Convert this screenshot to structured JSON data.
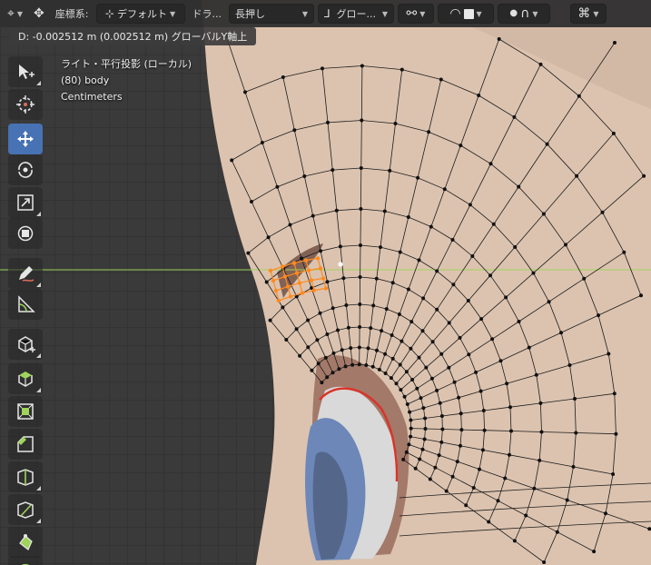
{
  "header": {
    "coord_label": "座標系:",
    "pivot_value": "デフォルト",
    "drag_label": "ドラ...",
    "drag_value": "長押し",
    "orientation_value": "グロー...",
    "icons": {
      "workspace": "transform-pivot-icon",
      "move": "move-arrows-icon",
      "pivot": "pivot-point-icon",
      "orientation": "orientation-axes-icon",
      "snap": "snap-link-icon",
      "proportional": "proportional-edit-icon",
      "falloff": "falloff-curve-icon",
      "overlay": "overlay-icon"
    }
  },
  "status": {
    "text": "D: -0.002512 m (0.002512 m) グローバルY軸上"
  },
  "viewport_info": {
    "mode": "ライト・平行投影 (ローカル)",
    "object": "(80) body",
    "units": "Centimeters"
  },
  "toolbar": {
    "tools": [
      {
        "name": "select-box-tool",
        "icon": "cursor-arrow-icon",
        "active": false,
        "corner": true
      },
      {
        "name": "cursor-tool",
        "icon": "3d-cursor-icon",
        "active": false,
        "corner": false
      },
      {
        "name": "move-tool",
        "icon": "move-arrows-icon",
        "active": true,
        "corner": false
      },
      {
        "name": "rotate-tool",
        "icon": "rotate-icon",
        "active": false,
        "corner": false
      },
      {
        "name": "scale-tool",
        "icon": "scale-icon",
        "active": false,
        "corner": true
      },
      {
        "name": "transform-tool",
        "icon": "transform-icon",
        "active": false,
        "corner": false
      },
      {
        "name": "annotate-tool",
        "icon": "pencil-icon",
        "active": false,
        "corner": true
      },
      {
        "name": "measure-tool",
        "icon": "ruler-icon",
        "active": false,
        "corner": false
      },
      {
        "name": "add-cube-tool",
        "icon": "add-cube-icon",
        "active": false,
        "corner": true
      },
      {
        "name": "extrude-tool",
        "icon": "extrude-icon",
        "active": false,
        "corner": true
      },
      {
        "name": "inset-tool",
        "icon": "inset-icon",
        "active": false,
        "corner": false
      },
      {
        "name": "bevel-tool",
        "icon": "bevel-icon",
        "active": false,
        "corner": false
      },
      {
        "name": "loop-cut-tool",
        "icon": "loop-cut-icon",
        "active": false,
        "corner": true
      },
      {
        "name": "knife-tool",
        "icon": "knife-icon",
        "active": false,
        "corner": true
      },
      {
        "name": "poly-build-tool",
        "icon": "poly-build-icon",
        "active": false,
        "corner": false
      },
      {
        "name": "spin-tool",
        "icon": "spin-icon",
        "active": false,
        "corner": true
      }
    ]
  },
  "colors": {
    "skin": "#dcc3af",
    "active_tool": "#4772b3",
    "selection": "#ff8a1f",
    "y_axis": "#9fd35b"
  }
}
